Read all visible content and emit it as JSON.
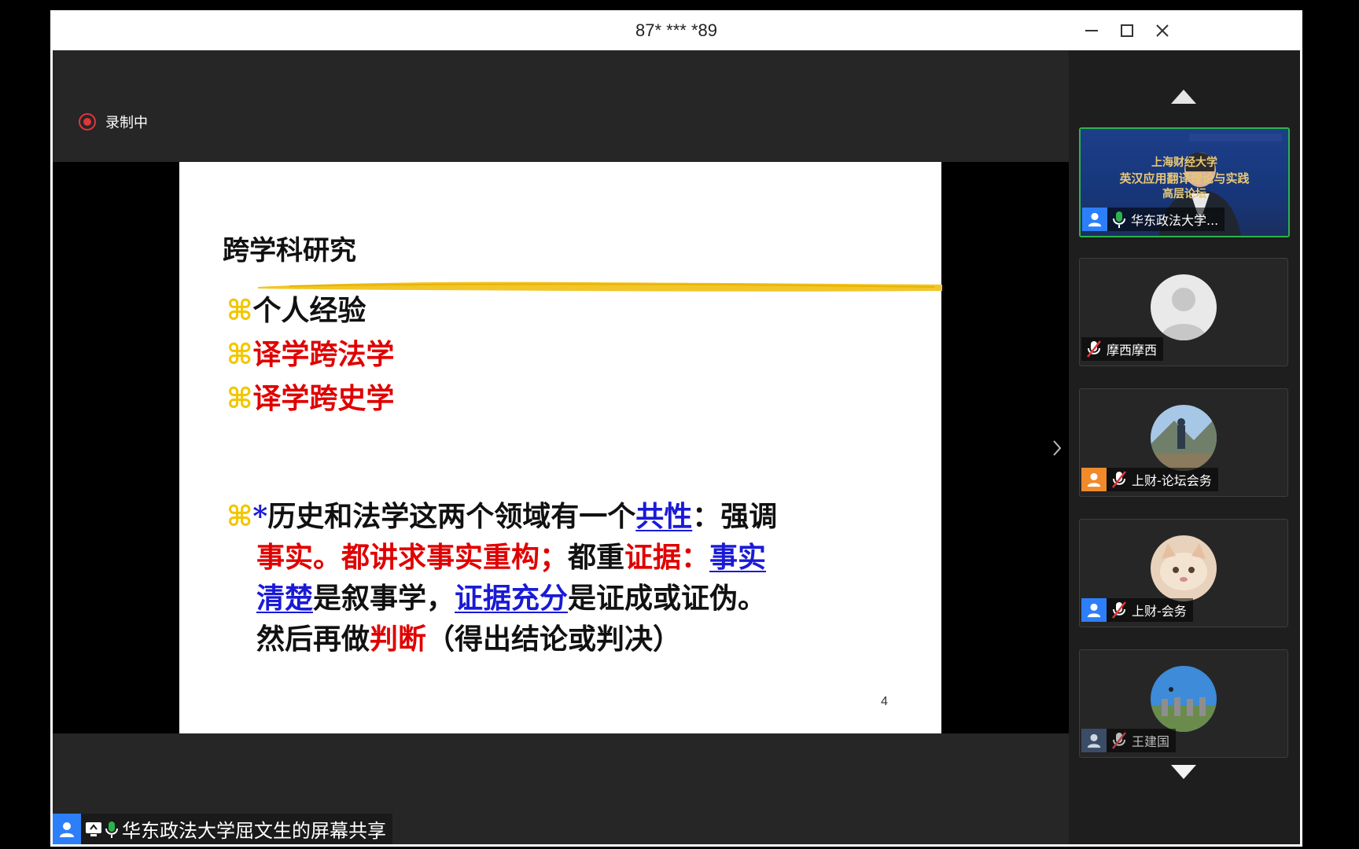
{
  "window": {
    "title": "87* *** *89",
    "minimize_icon": "minimize-icon",
    "maximize_icon": "maximize-icon",
    "close_icon": "close-icon"
  },
  "recording": {
    "label": "录制中",
    "color": "#e0353b"
  },
  "slide": {
    "title": "跨学科研究",
    "bullet_symbol": "⌘",
    "bullets": [
      {
        "text": "个人经验",
        "color": "#111111"
      },
      {
        "text": "译学跨法学",
        "color": "#e00000"
      },
      {
        "text": "译学跨史学",
        "color": "#e00000"
      }
    ],
    "paragraph": {
      "star": "*",
      "l1_a": "历史和法学这两个领域有一个",
      "l1_b": "共性",
      "l1_c": "：强调",
      "l2_a": "事实。都讲求事实重构；",
      "l2_b": "都重",
      "l2_c": "证据：",
      "l2_d": "事实",
      "l3_a": "清楚",
      "l3_b": "是叙事学，",
      "l3_c": "证据充分",
      "l3_d": "是证成或证伪。",
      "l4_a": "然后再做",
      "l4_b": "判断",
      "l4_c": "（得出结论或判决）"
    },
    "page_number": "4"
  },
  "share_label": {
    "text": "华东政法大学屈文生的屏幕共享"
  },
  "participants": [
    {
      "name": "华东政法大学...",
      "role": "active-speaker",
      "video_line1": "上海财经大学",
      "video_line2": "英汉应用翻译理论与实践",
      "video_line3": "高层论坛"
    },
    {
      "name": "摩西摩西",
      "role": "muted"
    },
    {
      "name": "上财-论坛会务",
      "role": "muted"
    },
    {
      "name": "上财-会务",
      "role": "muted"
    },
    {
      "name": "王建国",
      "role": "muted"
    }
  ]
}
